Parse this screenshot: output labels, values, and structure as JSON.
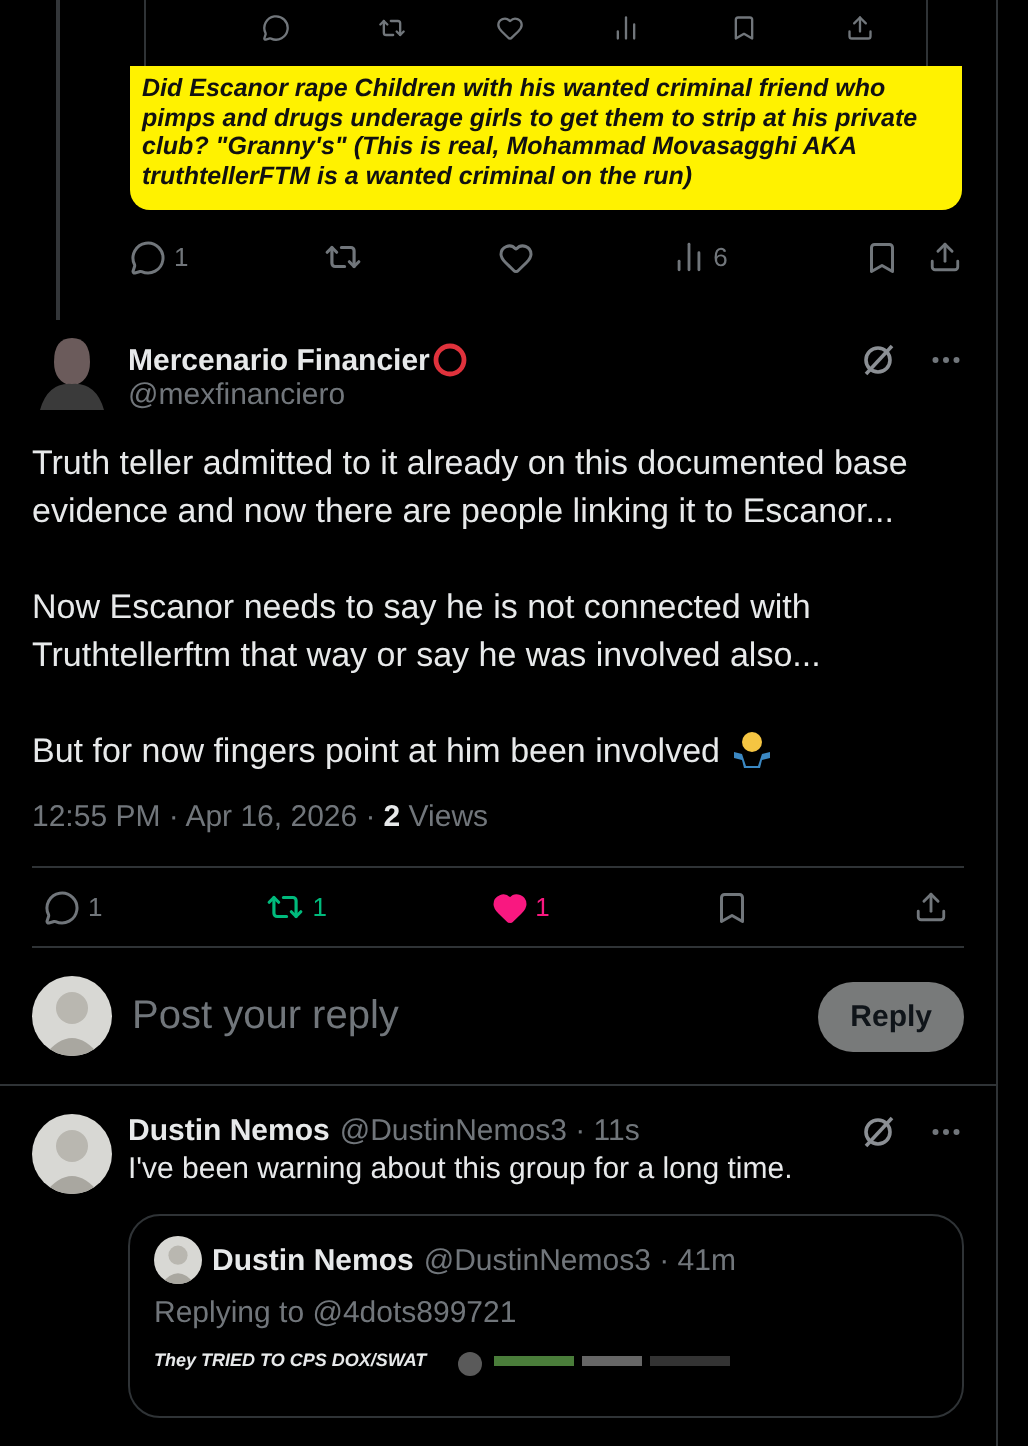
{
  "parent_post": {
    "embedded_actions": [
      {
        "kind": "reply"
      },
      {
        "kind": "repost"
      },
      {
        "kind": "like"
      },
      {
        "kind": "views"
      },
      {
        "kind": "bookmark"
      },
      {
        "kind": "share"
      }
    ],
    "image_text": "Did Escanor rape Children with his wanted criminal friend who pimps and drugs underage girls to get them to strip at his private club? \"Granny's\" (This is real, Mohammad Movasagghi AKA truthtellerFTM is a wanted criminal on the run)",
    "actions": [
      {
        "kind": "reply",
        "count": "1"
      },
      {
        "kind": "repost"
      },
      {
        "kind": "like"
      },
      {
        "kind": "views",
        "count": "6"
      },
      {
        "kind": "bookmark"
      },
      {
        "kind": "share"
      }
    ]
  },
  "post": {
    "name": "Mercenario Financier",
    "handle": "@mexfinanciero",
    "body": [
      "Truth teller admitted to it already on this documented base evidence and now there are people linking it to Escanor...",
      "Now Escanor needs to say he is not connected with Truthtellerftm that way or say he was involved also...",
      "But for now fingers point at him been involved"
    ],
    "timestamp": "12:55 PM · Apr 16, 2026 ·",
    "views_count": "2",
    "views_label": "Views",
    "actions": [
      {
        "kind": "reply",
        "count": "1",
        "active": false
      },
      {
        "kind": "repost",
        "count": "1",
        "active": true
      },
      {
        "kind": "like",
        "count": "1",
        "active": true
      },
      {
        "kind": "bookmark",
        "active": false
      },
      {
        "kind": "share"
      }
    ]
  },
  "composer": {
    "placeholder": "Post your reply",
    "button": "Reply"
  },
  "reply": {
    "name": "Dustin Nemos",
    "handle": "@DustinNemos3 · 11s",
    "text": "I've been warning about this group for a long time.",
    "quote": {
      "name": "Dustin Nemos",
      "handle": "@DustinNemos3 · 41m",
      "replying_to": "Replying to @4dots899721",
      "media_text": "They TRIED TO CPS DOX/SWAT"
    }
  }
}
